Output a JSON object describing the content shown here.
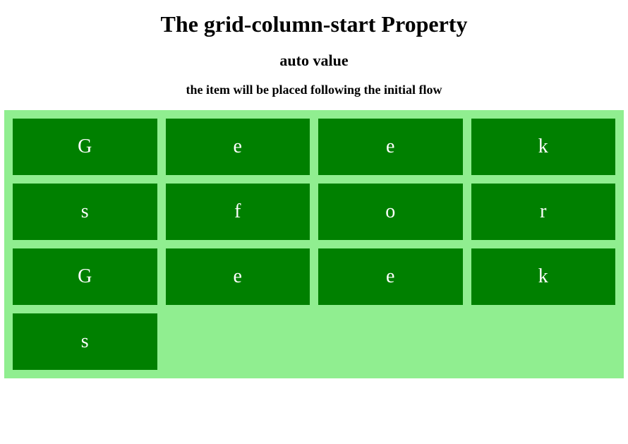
{
  "headings": {
    "main": "The grid-column-start Property",
    "sub": "auto value",
    "desc": "the item will be placed following the initial flow"
  },
  "grid": {
    "items": [
      "G",
      "e",
      "e",
      "k",
      "s",
      "f",
      "o",
      "r",
      "G",
      "e",
      "e",
      "k",
      "s"
    ]
  }
}
